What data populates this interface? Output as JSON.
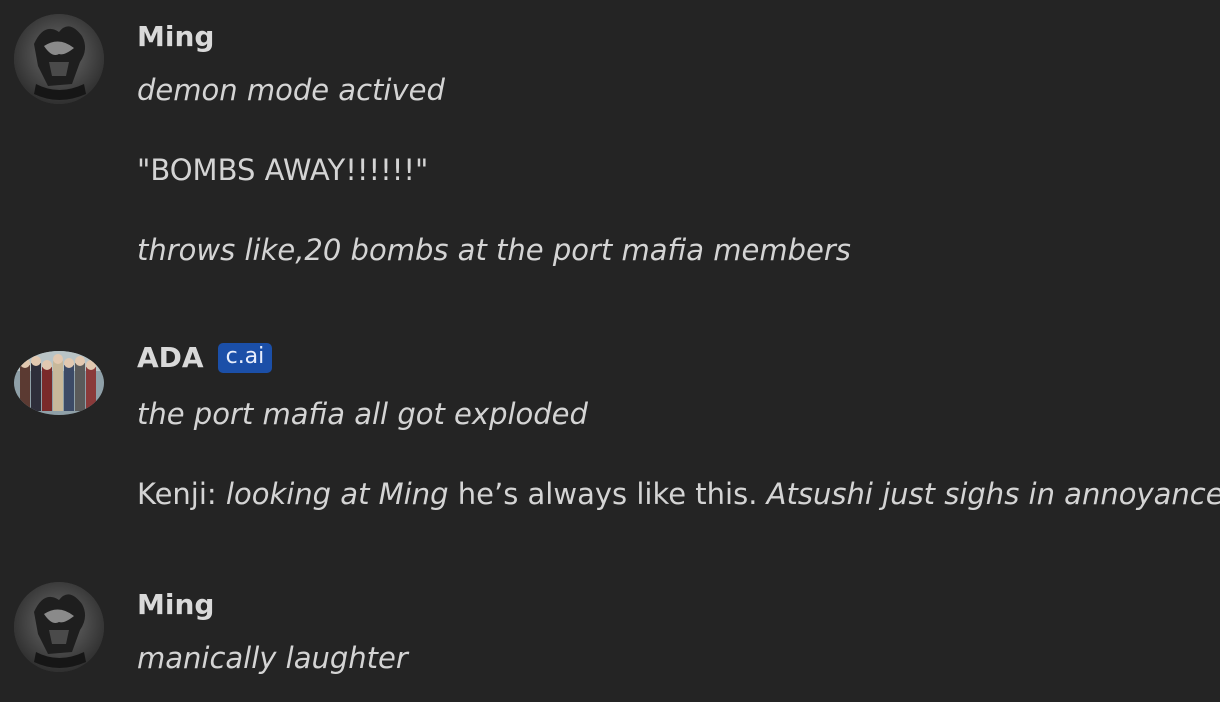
{
  "messages": [
    {
      "author": "Ming",
      "avatar_icon": "ming-avatar-icon",
      "lines": [
        {
          "text": "demon mode actived",
          "style": "italic"
        },
        {
          "text": "\"BOMBS AWAY!!!!!!\"",
          "style": "normal"
        },
        {
          "text": "throws like,20 bombs at the port mafia members",
          "style": "italic"
        }
      ]
    },
    {
      "author": "ADA",
      "badge": "c.ai",
      "avatar_icon": "ada-group-avatar-icon",
      "lines": [
        {
          "text": "the port mafia all got exploded",
          "style": "italic"
        },
        {
          "segments": [
            {
              "text": "Kenji: ",
              "style": "normal"
            },
            {
              "text": "looking at Ming",
              "style": "italic"
            },
            {
              "text": " he’s always like this. ",
              "style": "normal"
            },
            {
              "text": "Atsushi just sighs in annoyance",
              "style": "italic"
            }
          ]
        }
      ]
    },
    {
      "author": "Ming",
      "avatar_icon": "ming-avatar-icon",
      "lines": [
        {
          "text": "manically laughter",
          "style": "italic"
        }
      ]
    }
  ],
  "colors": {
    "background": "#242424",
    "text": "#d4d4d4",
    "badge": "#1b4fa8"
  }
}
